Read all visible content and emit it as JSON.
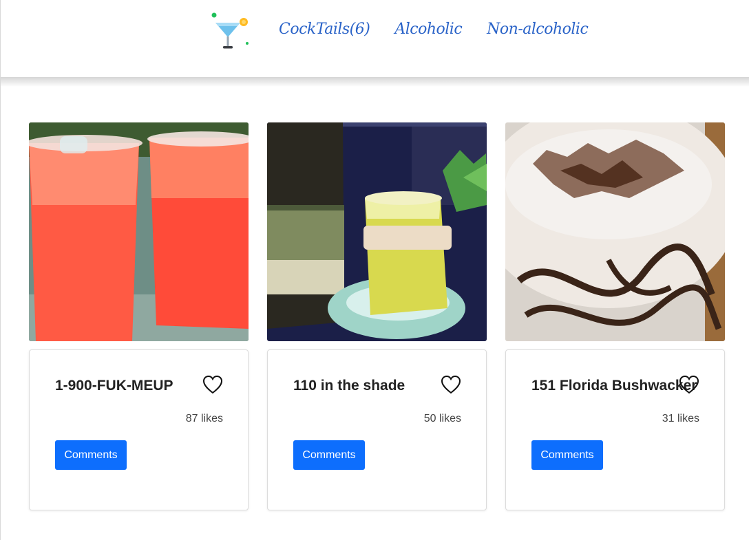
{
  "nav": {
    "logo_icon": "cocktail-glass-icon",
    "items": [
      {
        "label": "CockTails(6)"
      },
      {
        "label": "Alcoholic"
      },
      {
        "label": "Non-alcoholic"
      }
    ]
  },
  "cards": [
    {
      "title": "1-900-FUK-MEUP",
      "likes": "87 likes",
      "button": "Comments",
      "image": "red-punch-cups-photo"
    },
    {
      "title": "110 in the shade",
      "likes": "50 likes",
      "button": "Comments",
      "image": "yellow-cocktail-bottle-photo"
    },
    {
      "title": "151 Florida Bushwacker",
      "likes": "31 likes",
      "button": "Comments",
      "image": "chocolate-shake-photo"
    }
  ],
  "colors": {
    "accent": "#0d6efd",
    "nav_link": "#2a63c8"
  }
}
